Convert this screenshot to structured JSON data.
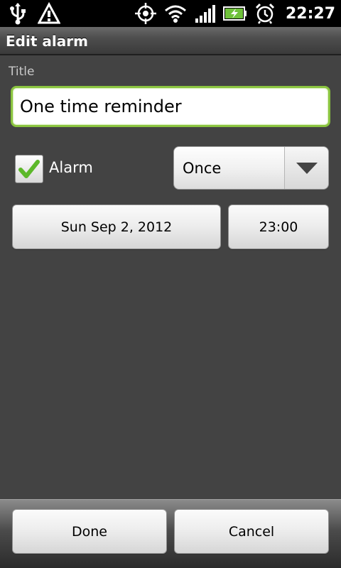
{
  "status_bar": {
    "time": "22:27",
    "icons": [
      "usb-icon",
      "warning-icon",
      "gps-icon",
      "wifi-icon",
      "signal-icon",
      "battery-icon",
      "alarm-clock-icon"
    ]
  },
  "title_bar": {
    "title": "Edit alarm"
  },
  "form": {
    "title_label": "Title",
    "title_value": "One time reminder",
    "alarm_label": "Alarm",
    "alarm_checked": true,
    "repeat_value": "Once",
    "date_value": "Sun Sep 2, 2012",
    "time_value": "23:00"
  },
  "actions": {
    "done_label": "Done",
    "cancel_label": "Cancel"
  },
  "colors": {
    "accent": "#8ac43f",
    "background": "#434343",
    "check": "#5cb82a"
  }
}
